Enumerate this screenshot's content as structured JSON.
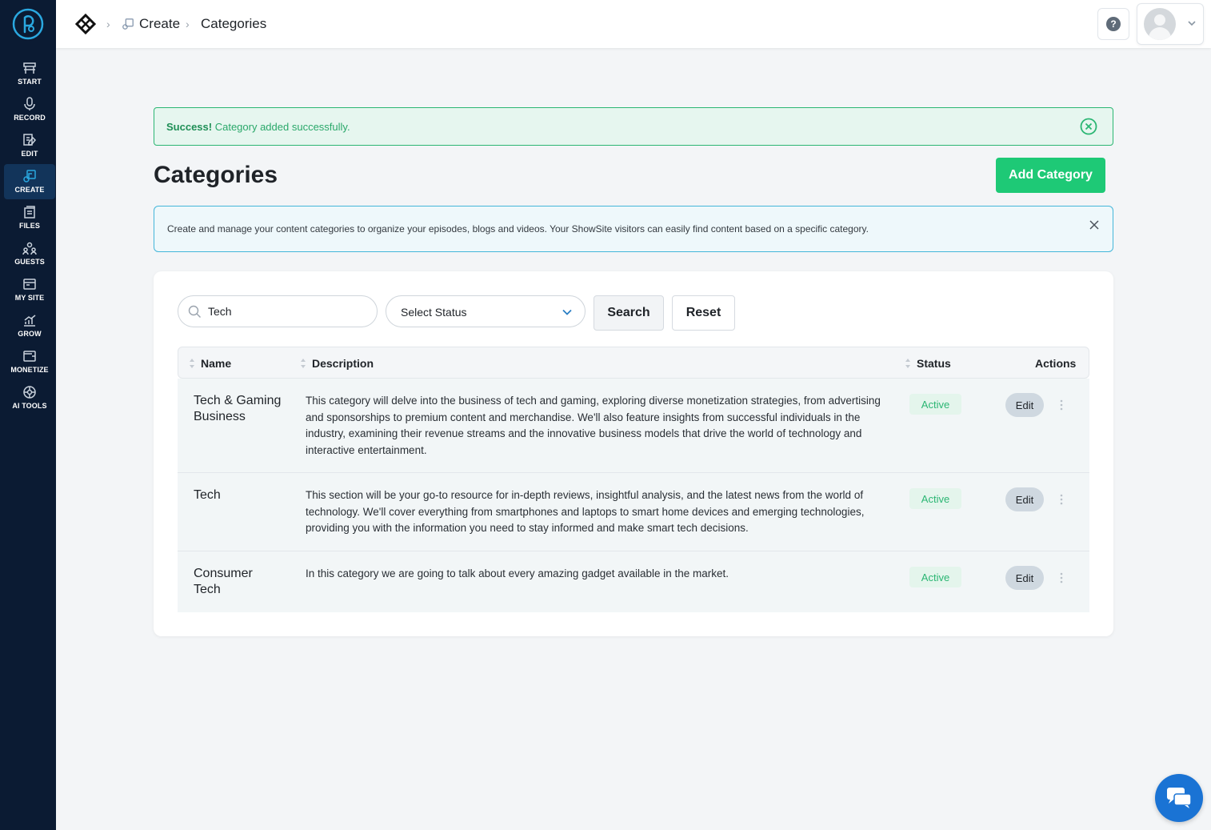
{
  "sidebar": {
    "items": [
      {
        "label": "START",
        "icon": "start-icon"
      },
      {
        "label": "RECORD",
        "icon": "microphone-icon"
      },
      {
        "label": "EDIT",
        "icon": "edit-icon"
      },
      {
        "label": "CREATE",
        "icon": "create-icon",
        "active": true
      },
      {
        "label": "FILES",
        "icon": "files-icon"
      },
      {
        "label": "GUESTS",
        "icon": "guests-icon"
      },
      {
        "label": "MY SITE",
        "icon": "my-site-icon"
      },
      {
        "label": "GROW",
        "icon": "grow-icon"
      },
      {
        "label": "MONETIZE",
        "icon": "monetize-icon"
      },
      {
        "label": "AI TOOLS",
        "icon": "ai-tools-icon"
      }
    ]
  },
  "breadcrumb": {
    "items": [
      "Create",
      "Categories"
    ]
  },
  "alert": {
    "strong": "Success!",
    "message": "Category added successfully."
  },
  "page": {
    "title": "Categories",
    "add_button": "Add Category",
    "info": "Create and manage your content categories to organize your episodes, blogs and videos. Your ShowSite visitors can easily find content based on a specific category."
  },
  "filters": {
    "search_value": "Tech",
    "status_placeholder": "Select Status",
    "search_button": "Search",
    "reset_button": "Reset"
  },
  "table": {
    "columns": [
      "Name",
      "Description",
      "Status",
      "Actions"
    ],
    "rows": [
      {
        "name": "Tech & Gaming Business",
        "description": "This category will delve into the business of tech and gaming, exploring diverse monetization strategies, from advertising and sponsorships to premium content and merchandise. We'll also feature insights from successful individuals in the industry, examining their revenue streams and the innovative business models that drive the world of technology and interactive entertainment.",
        "status": "Active",
        "action": "Edit"
      },
      {
        "name": "Tech",
        "description": "This section will be your go-to resource for in-depth reviews, insightful analysis, and the latest news from the world of technology. We'll cover everything from smartphones and laptops to smart home devices and emerging technologies, providing you with the information you need to stay informed and make smart tech decisions.",
        "status": "Active",
        "action": "Edit"
      },
      {
        "name": "Consumer Tech",
        "description": "In this category we are going to talk about every amazing gadget available in the market.",
        "status": "Active",
        "action": "Edit"
      }
    ]
  },
  "colors": {
    "sidebar_bg": "#0b1b33",
    "accent_green": "#1ec976",
    "info_border": "#44b6d9",
    "chat_blue": "#1a73d4"
  }
}
